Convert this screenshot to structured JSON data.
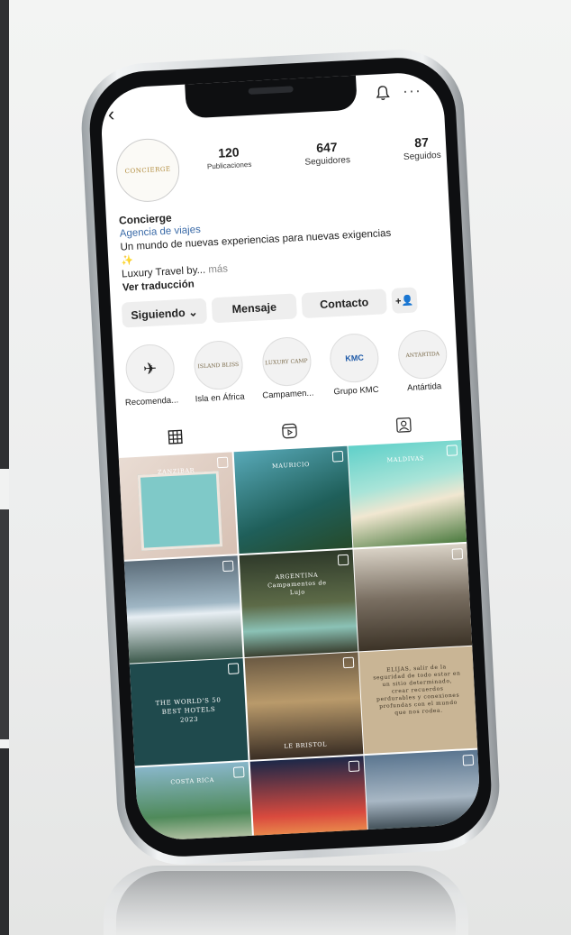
{
  "profile": {
    "logo_text": "CONCIERGE",
    "stats": [
      {
        "value": "120",
        "label": "Publicaciones"
      },
      {
        "value": "647",
        "label": "Seguidores"
      },
      {
        "value": "87",
        "label": "Seguidos"
      }
    ],
    "name": "Concierge",
    "category": "Agencia de viajes",
    "bio_line": "Un mundo de nuevas experiencias para nuevas exigencias",
    "bio_spark": "✨",
    "bio_line2": "Luxury Travel by...",
    "bio_more": " más",
    "translate": "Ver traducción"
  },
  "buttons": {
    "following": "Siguiendo ⌄",
    "message": "Mensaje",
    "contact": "Contacto",
    "add_user": "+👤"
  },
  "highlights": [
    {
      "label": "Recomenda...",
      "cover": "✈"
    },
    {
      "label": "Isla en África",
      "cover": "ISLAND BLISS"
    },
    {
      "label": "Campamen...",
      "cover": "LUXURY CAMP"
    },
    {
      "label": "Grupo KMC",
      "cover": "KMC"
    },
    {
      "label": "Antártida",
      "cover": "ANTÁRTIDA"
    }
  ],
  "tabs": [
    {
      "name": "grid-tab",
      "icon": "grid-icon"
    },
    {
      "name": "reels-tab",
      "icon": "reels-icon"
    },
    {
      "name": "tagged-tab",
      "icon": "tagged-icon"
    }
  ],
  "posts": [
    {
      "caption": "ZANZIBAR"
    },
    {
      "caption": "MAURICIO"
    },
    {
      "caption": "MALDIVAS"
    },
    {
      "caption": ""
    },
    {
      "caption": "ARGENTINA Campamentos de Lujo"
    },
    {
      "caption": ""
    },
    {
      "caption": "THE WORLD'S 50 BEST HOTELS 2023"
    },
    {
      "caption": "LE BRISTOL"
    },
    {
      "caption": "ELIJAS, salir de la seguridad de todo estar en un sitio determinado, crear recuerdos perdurables y conexiones profundas con el mundo que nos rodea."
    },
    {
      "caption": "COSTA RICA"
    },
    {
      "caption": ""
    },
    {
      "caption": ""
    }
  ]
}
